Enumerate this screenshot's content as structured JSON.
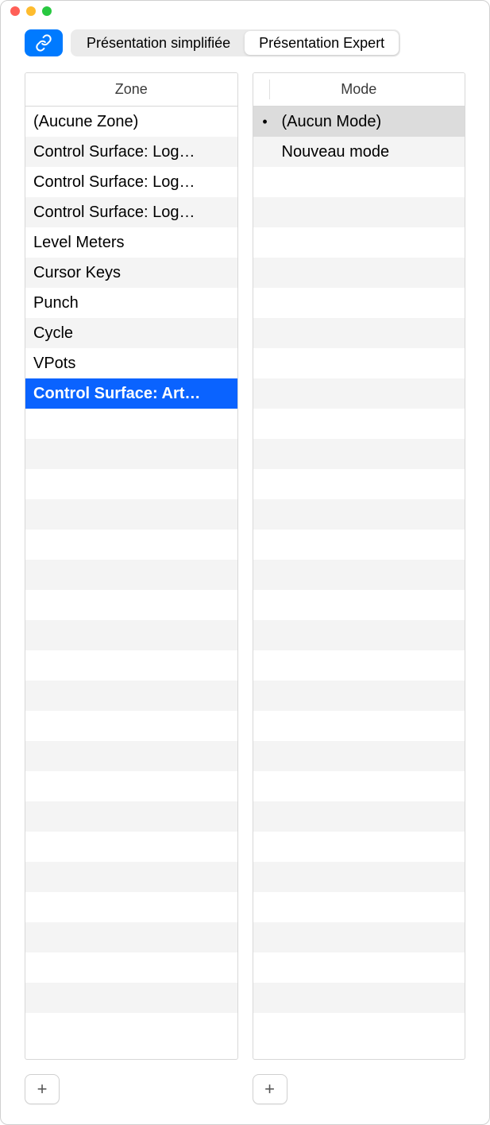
{
  "toolbar": {
    "segments": {
      "simple": "Présentation simplifiée",
      "expert": "Présentation Expert"
    },
    "active_segment": "expert"
  },
  "zone_panel": {
    "header": "Zone",
    "items": [
      {
        "label": "(Aucune Zone)",
        "selected": false
      },
      {
        "label": "Control Surface: Log…",
        "selected": false
      },
      {
        "label": "Control Surface: Log…",
        "selected": false
      },
      {
        "label": "Control Surface: Log…",
        "selected": false
      },
      {
        "label": "Level Meters",
        "selected": false
      },
      {
        "label": "Cursor Keys",
        "selected": false
      },
      {
        "label": "Punch",
        "selected": false
      },
      {
        "label": "Cycle",
        "selected": false
      },
      {
        "label": "VPots",
        "selected": false
      },
      {
        "label": "Control Surface: Art…",
        "selected": true
      }
    ],
    "empty_rows": 20,
    "add_label": "+"
  },
  "mode_panel": {
    "header": "Mode",
    "items": [
      {
        "label": "(Aucun Mode)",
        "indicator": true,
        "highlighted": true
      },
      {
        "label": "Nouveau mode",
        "indicator": false,
        "highlighted": false
      }
    ],
    "empty_rows": 28,
    "add_label": "+"
  },
  "icons": {
    "link": "link-icon",
    "plus": "plus-icon"
  }
}
